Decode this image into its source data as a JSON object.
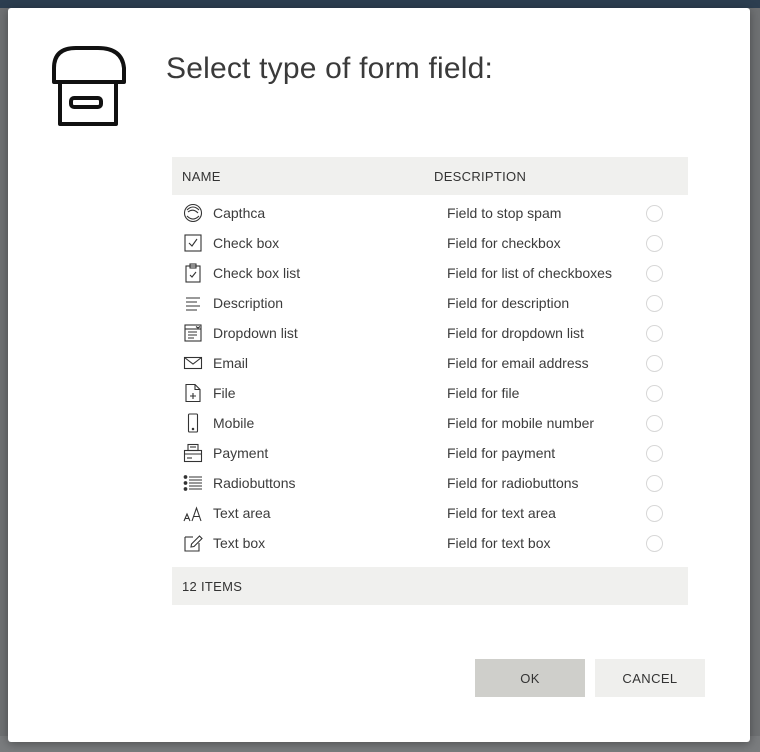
{
  "dialog": {
    "title": "Select type of form field:",
    "header_icon": "archive-box-icon"
  },
  "grid": {
    "columns": [
      "NAME",
      "DESCRIPTION"
    ],
    "rows": [
      {
        "icon": "captcha-icon",
        "name": "Capthca",
        "description": "Field to stop spam"
      },
      {
        "icon": "checkbox-icon",
        "name": "Check box",
        "description": "Field for checkbox"
      },
      {
        "icon": "clipboard-check-icon",
        "name": "Check box list",
        "description": "Field for list of checkboxes"
      },
      {
        "icon": "text-lines-icon",
        "name": "Description",
        "description": "Field for description"
      },
      {
        "icon": "dropdown-list-icon",
        "name": "Dropdown list",
        "description": "Field for dropdown list"
      },
      {
        "icon": "envelope-icon",
        "name": "Email",
        "description": "Field for email address"
      },
      {
        "icon": "file-add-icon",
        "name": "File",
        "description": "Field for file"
      },
      {
        "icon": "mobile-phone-icon",
        "name": "Mobile",
        "description": "Field for mobile number"
      },
      {
        "icon": "payment-terminal-icon",
        "name": "Payment",
        "description": "Field for payment"
      },
      {
        "icon": "bulleted-list-icon",
        "name": "Radiobuttons",
        "description": "Field for radiobuttons"
      },
      {
        "icon": "font-size-icon",
        "name": "Text area",
        "description": "Field for text area"
      },
      {
        "icon": "pencil-edit-icon",
        "name": "Text box",
        "description": "Field for text box"
      }
    ],
    "footer": "12 ITEMS"
  },
  "buttons": {
    "ok": "OK",
    "cancel": "CANCEL"
  }
}
